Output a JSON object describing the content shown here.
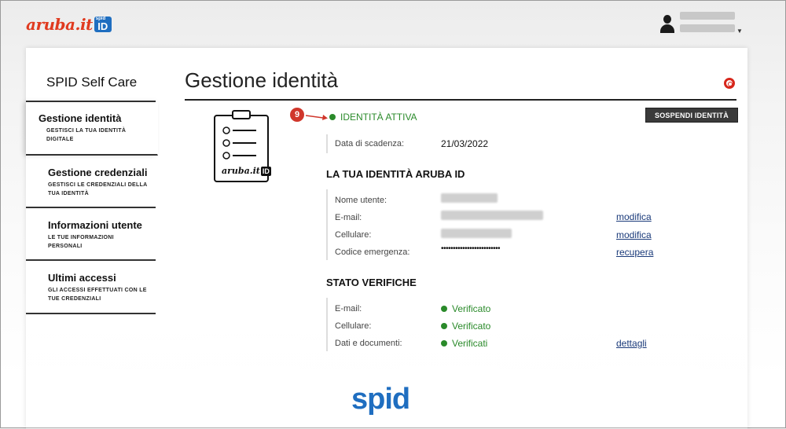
{
  "brand": {
    "logo_text": "aruba.it",
    "badge_top": "spid",
    "badge_id": "ID"
  },
  "sidebar": {
    "title": "SPID Self Care",
    "items": [
      {
        "label": "Gestione identità",
        "sub": "GESTISCI LA TUA IDENTITÀ DIGITALE",
        "active": true
      },
      {
        "label": "Gestione credenziali",
        "sub": "GESTISCI LE CREDENZIALI DELLA TUA IDENTITÀ"
      },
      {
        "label": "Informazioni utente",
        "sub": "LE TUE INFORMAZIONI PERSONALI"
      },
      {
        "label": "Ultimi accessi",
        "sub": "GLI ACCESSI EFFETTUATI CON LE TUE CREDENZIALI"
      }
    ]
  },
  "main": {
    "title": "Gestione identità",
    "step_badge": "9",
    "status": "IDENTITÀ ATTIVA",
    "suspend_button": "SOSPENDI IDENTITÀ",
    "clipboard_brand": "aruba.it",
    "clipboard_badge": "ID",
    "expiry": {
      "label": "Data di scadenza:",
      "value": "21/03/2022"
    },
    "identity_section": {
      "heading": "LA TUA IDENTITÀ ARUBA ID",
      "rows": [
        {
          "label": "Nome utente:",
          "value": "",
          "link": ""
        },
        {
          "label": "E-mail:",
          "value": "",
          "link": "modifica"
        },
        {
          "label": "Cellulare:",
          "value": "",
          "link": "modifica"
        },
        {
          "label": "Codice emergenza:",
          "value": "•••••••••••••••••••••••••",
          "link": "recupera"
        }
      ]
    },
    "verify_section": {
      "heading": "STATO VERIFICHE",
      "rows": [
        {
          "label": "E-mail:",
          "status": "Verificato",
          "link": ""
        },
        {
          "label": "Cellulare:",
          "status": "Verificato",
          "link": ""
        },
        {
          "label": "Dati e documenti:",
          "status": "Verificati",
          "link": "dettagli"
        }
      ]
    }
  },
  "footer": {
    "spid_logo": "spid"
  },
  "colors": {
    "accent_red": "#d0362b",
    "status_green": "#2a8a2a",
    "spid_blue": "#1f6ec0"
  }
}
